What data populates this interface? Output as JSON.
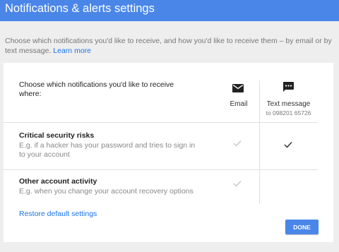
{
  "header": {
    "title": "Notifications & alerts settings"
  },
  "intro": {
    "text": "Choose which notifications you'd like to receive, and how you'd like to receive them – by email or by text message.",
    "learn_more": "Learn more"
  },
  "table": {
    "prompt": "Choose which notifications you'd like to receive where:",
    "columns": [
      {
        "label": "Email",
        "icon": "email-icon"
      },
      {
        "label": "Text message",
        "sublabel": "to 098201 65726",
        "icon": "text-message-icon"
      }
    ],
    "rows": [
      {
        "title": "Critical security risks",
        "description": "E.g. if a hacker has your password and tries to sign in to your account",
        "email": "checked-disabled",
        "text": "checked"
      },
      {
        "title": "Other account activity",
        "description": "E.g. when you change your account recovery options",
        "email": "checked-disabled",
        "text": "none"
      }
    ]
  },
  "restore_label": "Restore default settings",
  "done_label": "DONE",
  "colors": {
    "header_bg": "#4a86e8",
    "link": "#1a73e8",
    "page_bg": "#eeeeee",
    "card_bg": "#ffffff",
    "divider": "#e0e0e0"
  }
}
